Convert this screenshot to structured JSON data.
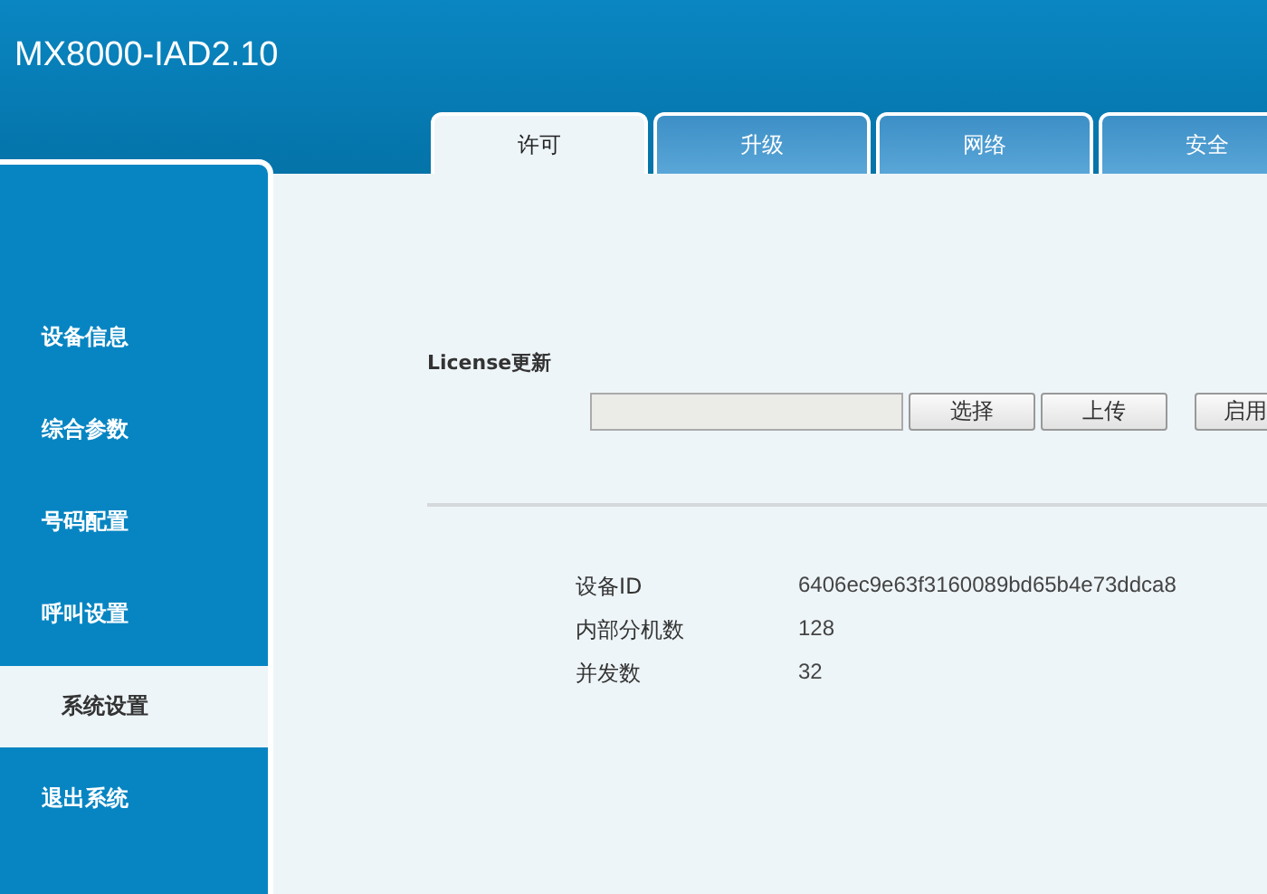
{
  "header": {
    "title": "MX8000-IAD2.10"
  },
  "tabs": [
    {
      "label": "许可",
      "selected": true
    },
    {
      "label": "升级",
      "selected": false
    },
    {
      "label": "网络",
      "selected": false
    },
    {
      "label": "安全",
      "selected": false
    }
  ],
  "sidebar": {
    "items": [
      {
        "label": "设备信息",
        "selected": false
      },
      {
        "label": "综合参数",
        "selected": false
      },
      {
        "label": "号码配置",
        "selected": false
      },
      {
        "label": "呼叫设置",
        "selected": false
      },
      {
        "label": "系统设置",
        "selected": true
      },
      {
        "label": "退出系统",
        "selected": false
      }
    ]
  },
  "license": {
    "title": "License更新",
    "buttons": [
      "选择",
      "上传",
      "启用"
    ]
  },
  "info": [
    {
      "label": "设备ID",
      "value": "6406ec9e63f3160089bd65b4e73ddca8"
    },
    {
      "label": "内部分机数",
      "value": "128"
    },
    {
      "label": "并发数",
      "value": "32"
    }
  ]
}
